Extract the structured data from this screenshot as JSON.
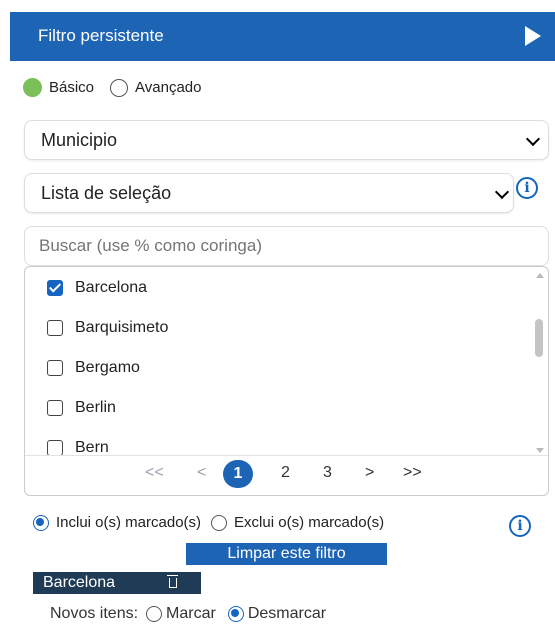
{
  "header": {
    "title": "Filtro persistente",
    "play_icon": "play-icon"
  },
  "mode": {
    "basic_label": "Básico",
    "advanced_label": "Avançado",
    "selected": "basic",
    "basic_color": "#7bbf59"
  },
  "field_select": {
    "value": "Municipio"
  },
  "type_select": {
    "value": "Lista de seleção"
  },
  "search": {
    "placeholder": "Buscar (use % como coringa)"
  },
  "list": {
    "items": [
      {
        "label": "Barcelona",
        "checked": true
      },
      {
        "label": "Barquisimeto",
        "checked": false
      },
      {
        "label": "Bergamo",
        "checked": false
      },
      {
        "label": "Berlin",
        "checked": false
      },
      {
        "label": "Bern",
        "checked": false
      }
    ]
  },
  "pagination": {
    "first": "<<",
    "prev": "<",
    "pages": [
      "1",
      "2",
      "3"
    ],
    "current": "1",
    "next": ">",
    "last": ">>"
  },
  "include_mode": {
    "include_label": "Inclui o(s) marcado(s)",
    "exclude_label": "Exclui o(s) marcado(s)",
    "selected": "include"
  },
  "clear_button": {
    "label": "Limpar este filtro"
  },
  "selected_tag": {
    "label": "Barcelona"
  },
  "new_items": {
    "label": "Novos itens:",
    "mark_label": "Marcar",
    "unmark_label": "Desmarcar",
    "selected": "unmark"
  },
  "colors": {
    "primary": "#1e64b4",
    "tag_bg": "#1f3b55"
  }
}
